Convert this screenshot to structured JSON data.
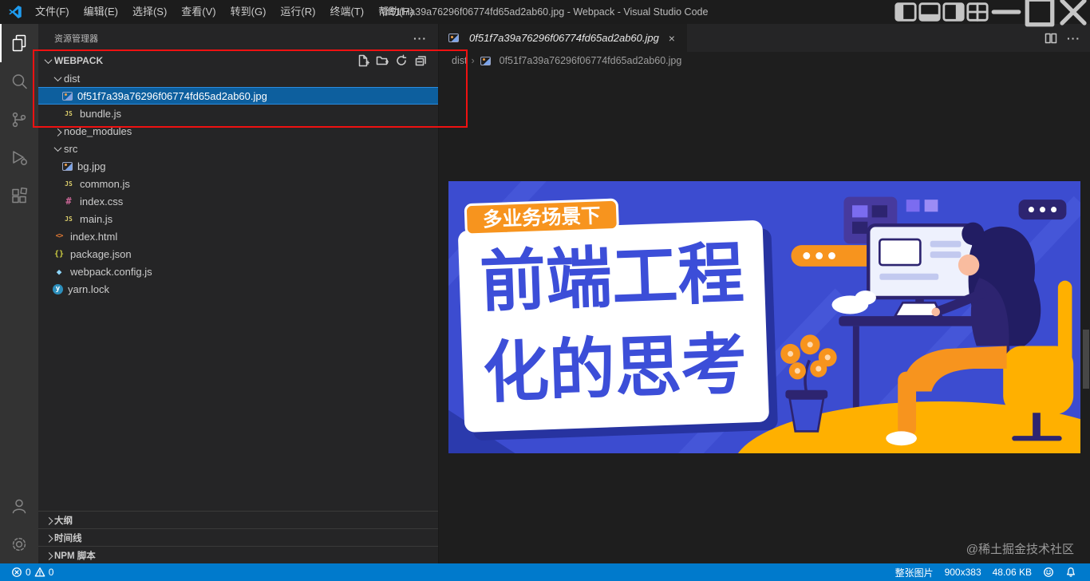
{
  "colors": {
    "accent_status_bar": "#007acc",
    "selection_bg": "#0d5f9e",
    "selection_border": "#2a8ce0",
    "annotation_red": "#ef1111",
    "activity_bar_bg": "#333333",
    "sidebar_bg": "#252526",
    "editor_bg": "#1e1e1e",
    "poster_blue": "#3c4cd0",
    "poster_orange": "#f7941e",
    "poster_yellow": "#ffb000"
  },
  "icons": {
    "activity_bar": [
      "explorer-icon",
      "search-icon",
      "source-control-icon",
      "run-and-debug-icon",
      "extensions-icon",
      "accounts-icon",
      "settings-gear-icon"
    ],
    "explorer_actions": [
      "new-file-icon",
      "new-folder-icon",
      "refresh-explorer-icon",
      "collapse-folders-icon"
    ],
    "title_bar": [
      "vscode-logo",
      "toggle-sidebar-icon",
      "toggle-panel-icon",
      "toggle-secondary-sidebar-icon",
      "customize-layout-icon",
      "minimize-icon",
      "maximize-icon",
      "close-icon"
    ],
    "editor": [
      "split-editor-icon",
      "more-actions-icon",
      "image-file-icon"
    ],
    "status_bar": [
      "error-icon",
      "warning-icon",
      "feedback-icon",
      "bell-icon"
    ]
  },
  "title_bar": {
    "app_title": "0f51f7a39a76296f06774fd65ad2ab60.jpg - Webpack - Visual Studio Code",
    "menus": [
      "文件(F)",
      "编辑(E)",
      "选择(S)",
      "查看(V)",
      "转到(G)",
      "运行(R)",
      "终端(T)",
      "帮助(H)"
    ]
  },
  "explorer": {
    "title": "资源管理器",
    "project": "WEBPACK",
    "files": [
      "dist",
      "0f51f7a39a76296f06774fd65ad2ab60.jpg",
      "bundle.js",
      "node_modules",
      "src",
      "bg.jpg",
      "common.js",
      "index.css",
      "main.js",
      "index.html",
      "package.json",
      "webpack.config.js",
      "yarn.lock"
    ],
    "panels": [
      "大纲",
      "时间线",
      "NPM 脚本"
    ]
  },
  "editor": {
    "tab_label": "0f51f7a39a76296f06774fd65ad2ab60.jpg",
    "breadcrumb": [
      "dist",
      "0f51f7a39a76296f06774fd65ad2ab60.jpg"
    ],
    "watermark": "@稀土掘金技术社区"
  },
  "poster": {
    "badge": "多业务场景下",
    "title_line1": "前端工程",
    "title_line2": "化的思考"
  },
  "status_bar": {
    "errors": "0",
    "warnings": "0",
    "image_mode": "整张图片",
    "dimensions": "900x383",
    "file_size": "48.06 KB"
  }
}
